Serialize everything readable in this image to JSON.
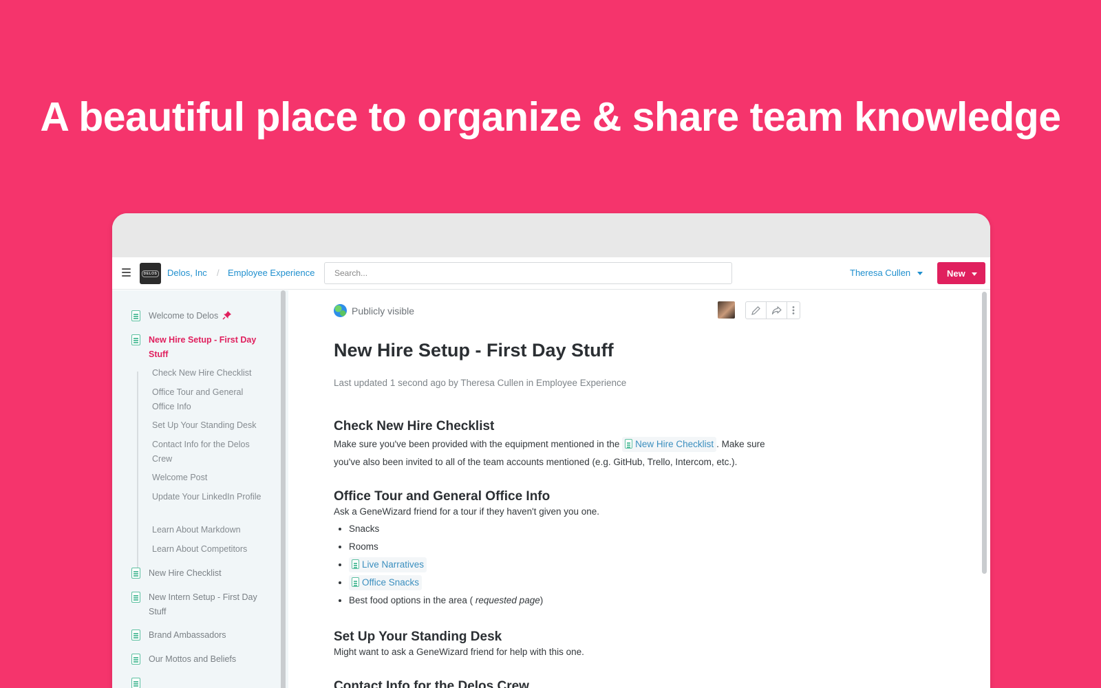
{
  "hero": {
    "headline": "A beautiful place to organize & share team knowledge"
  },
  "topbar": {
    "logo_text": "DELOS",
    "org": "Delos, Inc",
    "crumb_sep": "/",
    "collection": "Employee Experience",
    "search_placeholder": "Search...",
    "user": "Theresa Cullen",
    "new_label": "New"
  },
  "sidebar": {
    "items": [
      {
        "label": "Welcome to Delos"
      },
      {
        "label": "New Hire Setup - First Day Stuff"
      }
    ],
    "children": [
      "Check New Hire Checklist",
      "Office Tour and General Office Info",
      "Set Up Your Standing Desk",
      "Contact Info for the Delos Crew",
      "Welcome Post",
      "Update Your LinkedIn Profile",
      "Learn About Markdown",
      "Learn About Competitors"
    ],
    "more_items": [
      "New Hire Checklist",
      "New Intern Setup - First Day Stuff",
      "Brand Ambassadors",
      "Our Mottos and Beliefs"
    ]
  },
  "doc": {
    "visibility": "Publicly visible",
    "title": "New Hire Setup - First Day Stuff",
    "meta": "Last updated 1 second ago by Theresa Cullen in Employee Experience",
    "sections": {
      "s1_heading": "Check New Hire Checklist",
      "s1_text_a": "Make sure you've been provided with the equipment mentioned in the",
      "s1_link": "New Hire Checklist",
      "s1_text_b": ".  Make sure",
      "s1_text_c": "you've also been invited to all of the team accounts mentioned (e.g. GitHub, Trello, Intercom, etc.).",
      "s2_heading": "Office Tour and General Office Info",
      "s2_text": "Ask a GeneWizard friend for a tour if they haven't given you one.",
      "s2_list": {
        "snacks": "Snacks",
        "rooms": "Rooms",
        "link1": "Live Narratives",
        "link2": "Office Snacks",
        "food_a": "Best food options in the area (",
        "food_em": "requested page",
        "food_b": ")"
      },
      "s3_heading": "Set Up Your Standing Desk",
      "s3_text": "Might want to ask a GeneWizard friend for help with this one.",
      "s4_heading": "Contact Info for the Delos Crew"
    }
  }
}
